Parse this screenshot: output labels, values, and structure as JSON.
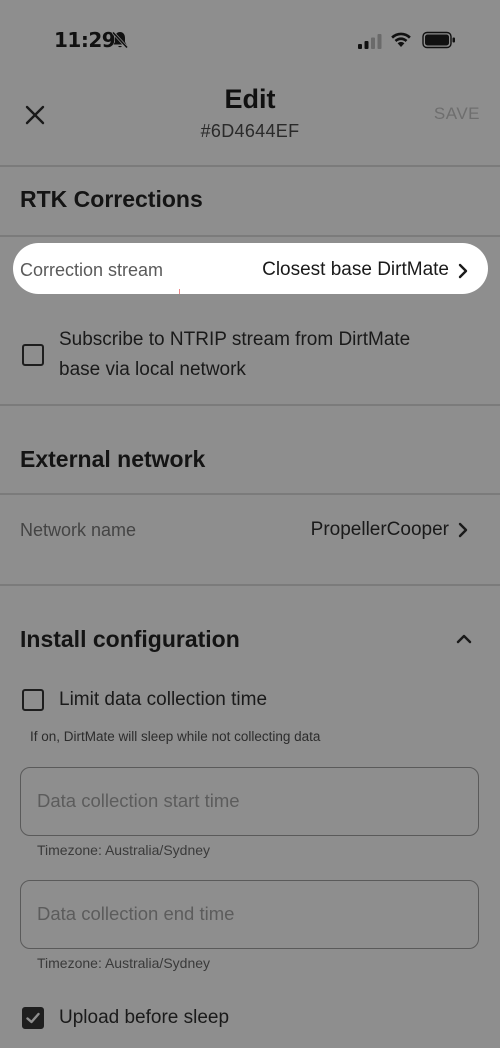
{
  "status_bar": {
    "time": "11:29"
  },
  "header": {
    "title": "Edit",
    "subtitle": "#6D4644EF",
    "save_label": "SAVE"
  },
  "rtk": {
    "section_title": "RTK Corrections",
    "correction_stream_label": "Correction stream",
    "correction_stream_value": "Closest base DirtMate",
    "subscribe_line1": "Subscribe to NTRIP stream from DirtMate",
    "subscribe_line2": "base via local network",
    "subscribe_checked": false
  },
  "external_network": {
    "section_title": "External network",
    "network_name_label": "Network name",
    "network_name_value": "PropellerCooper"
  },
  "install": {
    "section_title": "Install configuration",
    "limit_label": "Limit data collection time",
    "limit_checked": false,
    "limit_help": "If on, DirtMate will sleep while not collecting data",
    "start_placeholder": "Data collection start time",
    "start_timezone": "Timezone: Australia/Sydney",
    "end_placeholder": "Data collection end time",
    "end_timezone": "Timezone: Australia/Sydney",
    "upload_label": "Upload before sleep",
    "upload_checked": true
  },
  "colors": {
    "overlay_background": "#8e8e8e",
    "highlight": "#ffffff"
  }
}
